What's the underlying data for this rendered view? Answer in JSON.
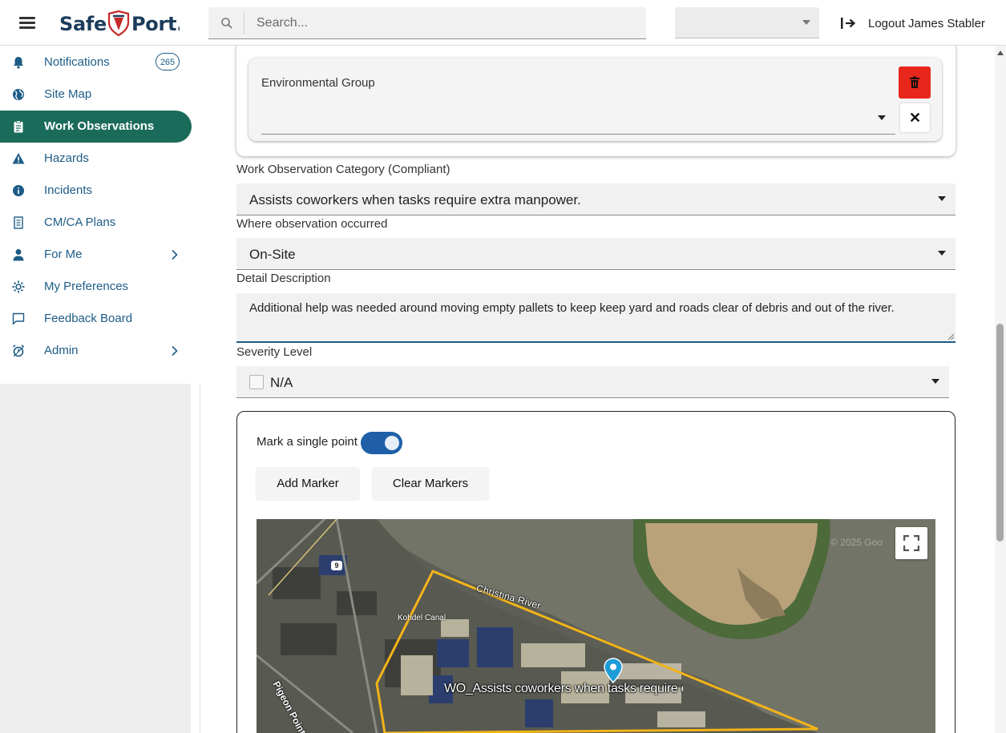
{
  "header": {
    "logo_text": "SafePort",
    "search_placeholder": "Search...",
    "top_select_value": "",
    "logout_label": "Logout James Stabler"
  },
  "sidebar": {
    "items": [
      {
        "label": "Notifications",
        "icon": "bell-icon",
        "badge": "265"
      },
      {
        "label": "Site Map",
        "icon": "globe-icon"
      },
      {
        "label": "Work Observations",
        "icon": "clipboard-icon",
        "active": true
      },
      {
        "label": "Hazards",
        "icon": "warning-icon"
      },
      {
        "label": "Incidents",
        "icon": "info-icon"
      },
      {
        "label": "CM/CA Plans",
        "icon": "document-icon"
      },
      {
        "label": "For Me",
        "icon": "person-icon",
        "has_children": true
      },
      {
        "label": "My Preferences",
        "icon": "gear-icon"
      },
      {
        "label": "Feedback Board",
        "icon": "chat-icon"
      },
      {
        "label": "Admin",
        "icon": "admin-icon",
        "has_children": true
      }
    ]
  },
  "form": {
    "environmental_group": {
      "title": "Environmental Group",
      "selected_value": ""
    },
    "category": {
      "label": "Work Observation Category (Compliant)",
      "value": "Assists coworkers when tasks require extra manpower."
    },
    "location": {
      "label": "Where observation occurred",
      "value": "On-Site"
    },
    "description": {
      "label": "Detail Description",
      "value": "Additional help was needed around moving empty pallets to keep keep yard and roads clear of debris and out of the river."
    },
    "severity": {
      "label": "Severity Level",
      "value": "N/A",
      "checked": false
    },
    "map_section": {
      "toggle_label": "Mark a single point",
      "toggle_on": true,
      "add_marker_label": "Add Marker",
      "clear_markers_label": "Clear Markers",
      "map": {
        "river_label": "Christina River",
        "canal_label": "Kohdel Canal",
        "road_label": "Pigeon Point R",
        "route_shield": "9",
        "copyright": "© 2025 Goo",
        "marker_label": "WO_Assists coworkers when tasks require extra manpower.",
        "boundary_color": "#f2b418",
        "marker_color": "#1d9bd7"
      }
    }
  },
  "colors": {
    "brand": "#1b3c5a",
    "nav_active": "#1b6b5a",
    "nav_text": "#1d5c86",
    "delete": "#e8261c",
    "toggle": "#1e5fa8"
  }
}
